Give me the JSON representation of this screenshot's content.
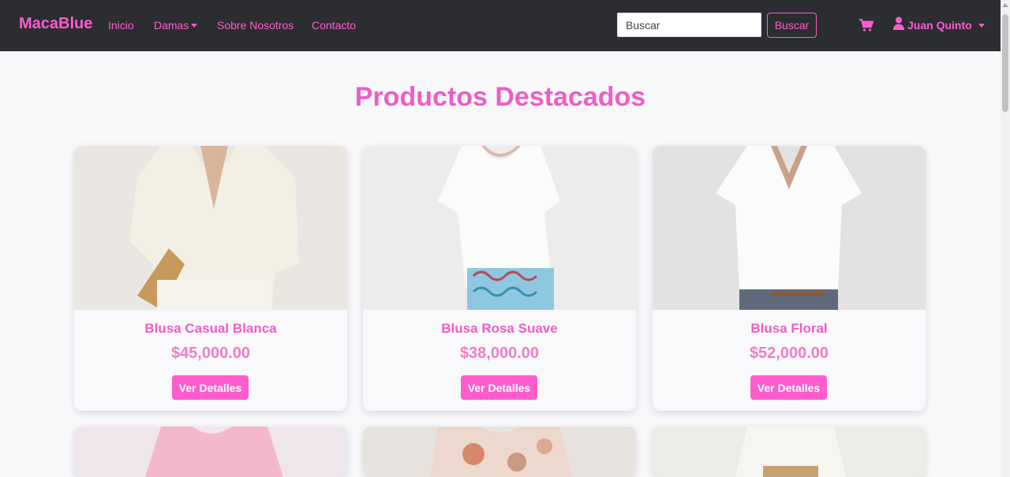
{
  "navbar": {
    "brand": "MacaBlue",
    "links": [
      {
        "label": "Inicio"
      },
      {
        "label": "Damas"
      },
      {
        "label": "Sobre Nosotros"
      },
      {
        "label": "Contacto"
      }
    ],
    "search": {
      "placeholder": "Buscar",
      "button_label": "Buscar"
    },
    "cart_icon": "shopping-cart-icon",
    "user": {
      "name": "Juan Quinto",
      "icon": "user-icon"
    }
  },
  "main": {
    "title": "Productos Destacados",
    "products": [
      {
        "name": "Blusa Casual Blanca",
        "price": "$45,000.00",
        "button": "Ver Detalles"
      },
      {
        "name": "Blusa Rosa Suave",
        "price": "$38,000.00",
        "button": "Ver Detalles"
      },
      {
        "name": "Blusa Floral",
        "price": "$52,000.00",
        "button": "Ver Detalles"
      }
    ]
  },
  "colors": {
    "accent": "#ff5ccd",
    "navbar": "#2b2d31",
    "background": "#f8f8fb"
  }
}
